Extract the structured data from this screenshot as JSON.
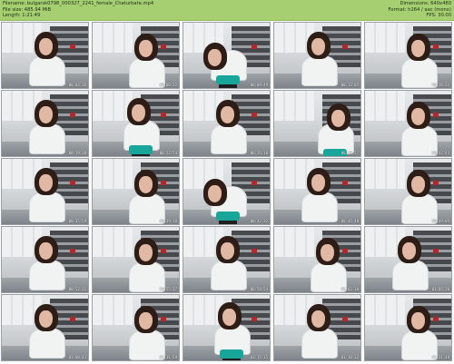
{
  "header": {
    "left_lines": [
      "Filename: bulgarsk0798_000327_2241_female_Chaturbate.mp4",
      "File size: 485.94 MiB",
      "Length: 1:21:49"
    ],
    "right_lines": [
      "Dimensions: 640x480",
      "Format: h264 / aac (mono)",
      "FPS: 30.00"
    ]
  },
  "thumbnails": [
    {
      "timestamp": "00:03:16",
      "pose": "a"
    },
    {
      "timestamp": "00:06:32",
      "pose": "b"
    },
    {
      "timestamp": "00:09:49",
      "pose": "bend"
    },
    {
      "timestamp": "00:13:05",
      "pose": "a"
    },
    {
      "timestamp": "00:16:21",
      "pose": "b"
    },
    {
      "timestamp": "00:19:38",
      "pose": "a"
    },
    {
      "timestamp": "00:22:54",
      "pose": "back"
    },
    {
      "timestamp": "00:26:10",
      "pose": "a"
    },
    {
      "timestamp": "00:29:27",
      "pose": "side"
    },
    {
      "timestamp": "00:32:43",
      "pose": "b"
    },
    {
      "timestamp": "00:35:59",
      "pose": "a"
    },
    {
      "timestamp": "00:39:16",
      "pose": "b"
    },
    {
      "timestamp": "00:42:32",
      "pose": "bend"
    },
    {
      "timestamp": "00:45:48",
      "pose": "a"
    },
    {
      "timestamp": "00:49:05",
      "pose": "b"
    },
    {
      "timestamp": "00:52:21",
      "pose": "a"
    },
    {
      "timestamp": "00:55:37",
      "pose": "b"
    },
    {
      "timestamp": "00:58:54",
      "pose": "a"
    },
    {
      "timestamp": "01:02:10",
      "pose": "b"
    },
    {
      "timestamp": "01:05:26",
      "pose": "a"
    },
    {
      "timestamp": "01:08:43",
      "pose": "a"
    },
    {
      "timestamp": "01:11:59",
      "pose": "b"
    },
    {
      "timestamp": "01:15:15",
      "pose": "back"
    },
    {
      "timestamp": "01:18:32",
      "pose": "a"
    },
    {
      "timestamp": "01:21:48",
      "pose": "b"
    }
  ],
  "colors": {
    "header_bg": "#a6cf72",
    "shirt": "#f1f2f2",
    "skirt": "#18a69a",
    "hair": "#2e1d16",
    "kitchen_accent": "#b3262a"
  }
}
